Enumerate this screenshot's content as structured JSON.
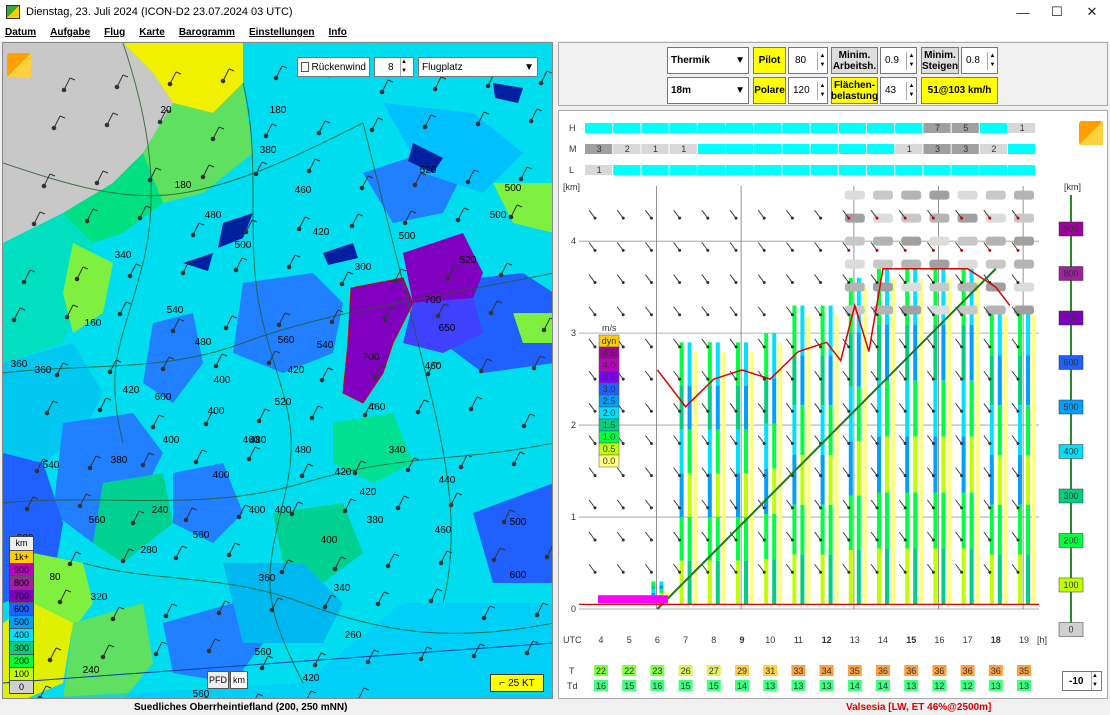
{
  "window": {
    "title": "Dienstag, 23. Juli 2024 (ICON-D2 23.07.2024 03 UTC)",
    "minimize": "—",
    "maximize": "☐",
    "close": "✕"
  },
  "menu": [
    "Datum",
    "Aufgabe",
    "Flug",
    "Karte",
    "Barogramm",
    "Einstellungen",
    "Info"
  ],
  "map": {
    "rueckenwind_label": "Rückenwind",
    "rueckenwind_checked": false,
    "level_value": "8",
    "layer_select": "Flugplatz",
    "height_labels": [
      "20",
      "180",
      "380",
      "520",
      "500",
      "480",
      "500",
      "420",
      "300",
      "500",
      "460",
      "340",
      "180",
      "540",
      "160",
      "480",
      "700",
      "650",
      "520",
      "360",
      "460",
      "560",
      "540",
      "500",
      "700",
      "600",
      "420",
      "400",
      "520",
      "460",
      "480",
      "400",
      "380",
      "460",
      "400",
      "340",
      "540",
      "400",
      "480",
      "420",
      "420",
      "440",
      "400",
      "560",
      "240",
      "560",
      "400",
      "380",
      "400",
      "280",
      "320",
      "360",
      "340",
      "560",
      "600",
      "500",
      "240",
      "220",
      "80",
      "260",
      "420",
      "560",
      "360",
      "460",
      "420"
    ],
    "legend_unit": "km",
    "legend": [
      {
        "label": "1k+",
        "color": "#ffcc00"
      },
      {
        "label": "900",
        "color": "#c000c0"
      },
      {
        "label": "800",
        "color": "#a020a0"
      },
      {
        "label": "700",
        "color": "#8000c0"
      },
      {
        "label": "600",
        "color": "#2060ff"
      },
      {
        "label": "500",
        "color": "#00a0ff"
      },
      {
        "label": "400",
        "color": "#00e0ff"
      },
      {
        "label": "300",
        "color": "#00d080"
      },
      {
        "label": "200",
        "color": "#00ff40"
      },
      {
        "label": "100",
        "color": "#c0ff00"
      },
      {
        "label": "0",
        "color": "#d0d0d0"
      }
    ],
    "pfd_label": "PFD",
    "km_label": "km",
    "wind_button": "25 KT"
  },
  "controls": {
    "mode_select": "Thermik",
    "pilot_label": "Pilot",
    "pilot_value": "80",
    "min_arbeitsh_label": "Minim. Arbeitsh.",
    "min_arbeitsh_value": "0.9",
    "min_steigen_label": "Minim. Steigen",
    "min_steigen_value": "0.8",
    "span_select": "18m",
    "polare_label": "Polare",
    "polare_value": "120",
    "flaechen_label": "Flächen-belastung",
    "flaechen_value": "43",
    "result": "51@103 km/h"
  },
  "chart_data": {
    "type": "table",
    "rows_cloud": [
      "H",
      "M",
      "L"
    ],
    "h_cover": [
      "",
      "",
      "",
      "",
      "",
      "",
      "",
      "",
      "",
      "",
      "",
      "",
      "7",
      "5",
      "",
      "1"
    ],
    "m_cover": [
      "3",
      "2",
      "1",
      "1",
      "",
      "",
      "",
      "",
      "",
      "",
      "",
      "1",
      "3",
      "3",
      "2",
      ""
    ],
    "l_cover": [
      "1",
      "",
      "",
      "",
      "",
      "",
      "",
      "",
      "",
      "",
      "",
      "",
      "",
      "",
      "",
      ""
    ],
    "y_unit_left": "[km]",
    "y_ticks_left": [
      "0",
      "1",
      "2",
      "3",
      "4"
    ],
    "y_unit_right": "[km]",
    "y_ticks_right": [
      "900",
      "800",
      "700",
      "600",
      "500",
      "400",
      "300",
      "200",
      "100",
      "0"
    ],
    "x_label": "UTC",
    "x_unit": "[h]",
    "hours": [
      "4",
      "5",
      "6",
      "7",
      "8",
      "9",
      "10",
      "11",
      "12",
      "13",
      "14",
      "15",
      "16",
      "17",
      "18",
      "19"
    ],
    "climb_legend_unit": "m/s",
    "climb_legend": [
      {
        "label": "dyn",
        "color": "#ffcc00"
      },
      {
        "label": "4.5",
        "color": "#a000a0"
      },
      {
        "label": "4.0",
        "color": "#c000c0"
      },
      {
        "label": "3.5",
        "color": "#8000ff"
      },
      {
        "label": "3.0",
        "color": "#2060ff"
      },
      {
        "label": "2.5",
        "color": "#00a0ff"
      },
      {
        "label": "2.0",
        "color": "#00e0ff"
      },
      {
        "label": "1.5",
        "color": "#00d080"
      },
      {
        "label": "1.0",
        "color": "#00ff40"
      },
      {
        "label": "0.5",
        "color": "#c0ff00"
      },
      {
        "label": "0.0",
        "color": "#ffff80"
      }
    ],
    "thermal_top_km": [
      0,
      0,
      0.3,
      2.9,
      2.9,
      2.9,
      3.0,
      3.3,
      3.3,
      3.6,
      3.7,
      3.7,
      3.7,
      3.7,
      3.3,
      3.3
    ],
    "T_label": "T",
    "Td_label": "Td",
    "T": [
      "22",
      "22",
      "23",
      "26",
      "27",
      "29",
      "31",
      "33",
      "34",
      "35",
      "36",
      "36",
      "36",
      "36",
      "36",
      "35"
    ],
    "Td": [
      "16",
      "15",
      "16",
      "15",
      "15",
      "14",
      "13",
      "13",
      "13",
      "14",
      "14",
      "13",
      "12",
      "12",
      "13",
      "13"
    ],
    "offset_value": "-10"
  },
  "status": {
    "left": "Suedliches Oberrheintiefland (200, 250 mNN)",
    "right": "Valsesia [LW, ET  46%@2500m]"
  },
  "colors": {
    "accent_yellow": "#ffff00",
    "status_red": "#dd0000",
    "cloud_cyan": "#00ffff"
  }
}
